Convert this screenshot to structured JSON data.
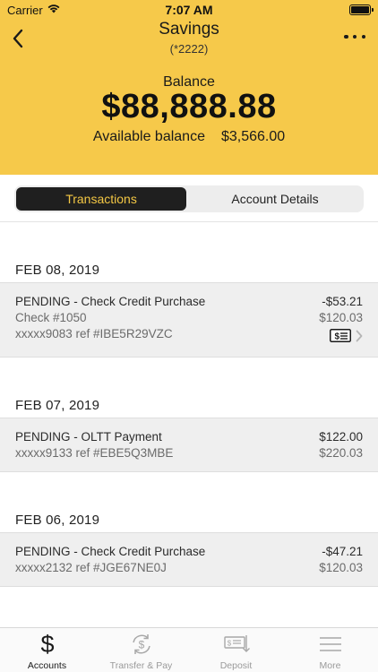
{
  "status_bar": {
    "carrier": "Carrier",
    "time": "7:07 AM"
  },
  "nav": {
    "title": "Savings",
    "subtitle": "(*2222)"
  },
  "balance": {
    "label": "Balance",
    "amount": "$88,888.88",
    "available_label": "Available balance",
    "available_amount": "$3,566.00"
  },
  "tabs_segment": {
    "active": "Transactions",
    "inactive": "Account Details"
  },
  "groups": [
    {
      "date": "FEB 08, 2019",
      "transactions": [
        {
          "line1": "PENDING - Check Credit Purchase",
          "line2": "Check #1050",
          "line3": "xxxxx9083 ref #IBE5R29VZC",
          "amount": "-$53.21",
          "running_balance": "$120.03",
          "has_check_icon": true
        }
      ]
    },
    {
      "date": "FEB 07, 2019",
      "transactions": [
        {
          "line1": "PENDING - OLTT Payment",
          "line2": "xxxxx9133 ref #EBE5Q3MBE",
          "amount": "$122.00",
          "running_balance": "$220.03"
        }
      ]
    },
    {
      "date": "FEB 06, 2019",
      "transactions": [
        {
          "line1": "PENDING - Check Credit Purchase",
          "line2": "xxxxx2132 ref #JGE67NE0J",
          "amount": "-$47.21",
          "running_balance": "$120.03"
        }
      ]
    }
  ],
  "tabbar": {
    "items": [
      {
        "label": "Accounts",
        "icon": "dollar-icon",
        "active": true
      },
      {
        "label": "Transfer & Pay",
        "icon": "transfer-icon",
        "active": false
      },
      {
        "label": "Deposit",
        "icon": "deposit-check-icon",
        "active": false
      },
      {
        "label": "More",
        "icon": "menu-icon",
        "active": false
      }
    ]
  },
  "colors": {
    "header_bg": "#f6c94a",
    "segment_active_bg": "#1f1f1f",
    "segment_active_text": "#f3c744",
    "row_bg": "#efefef"
  }
}
